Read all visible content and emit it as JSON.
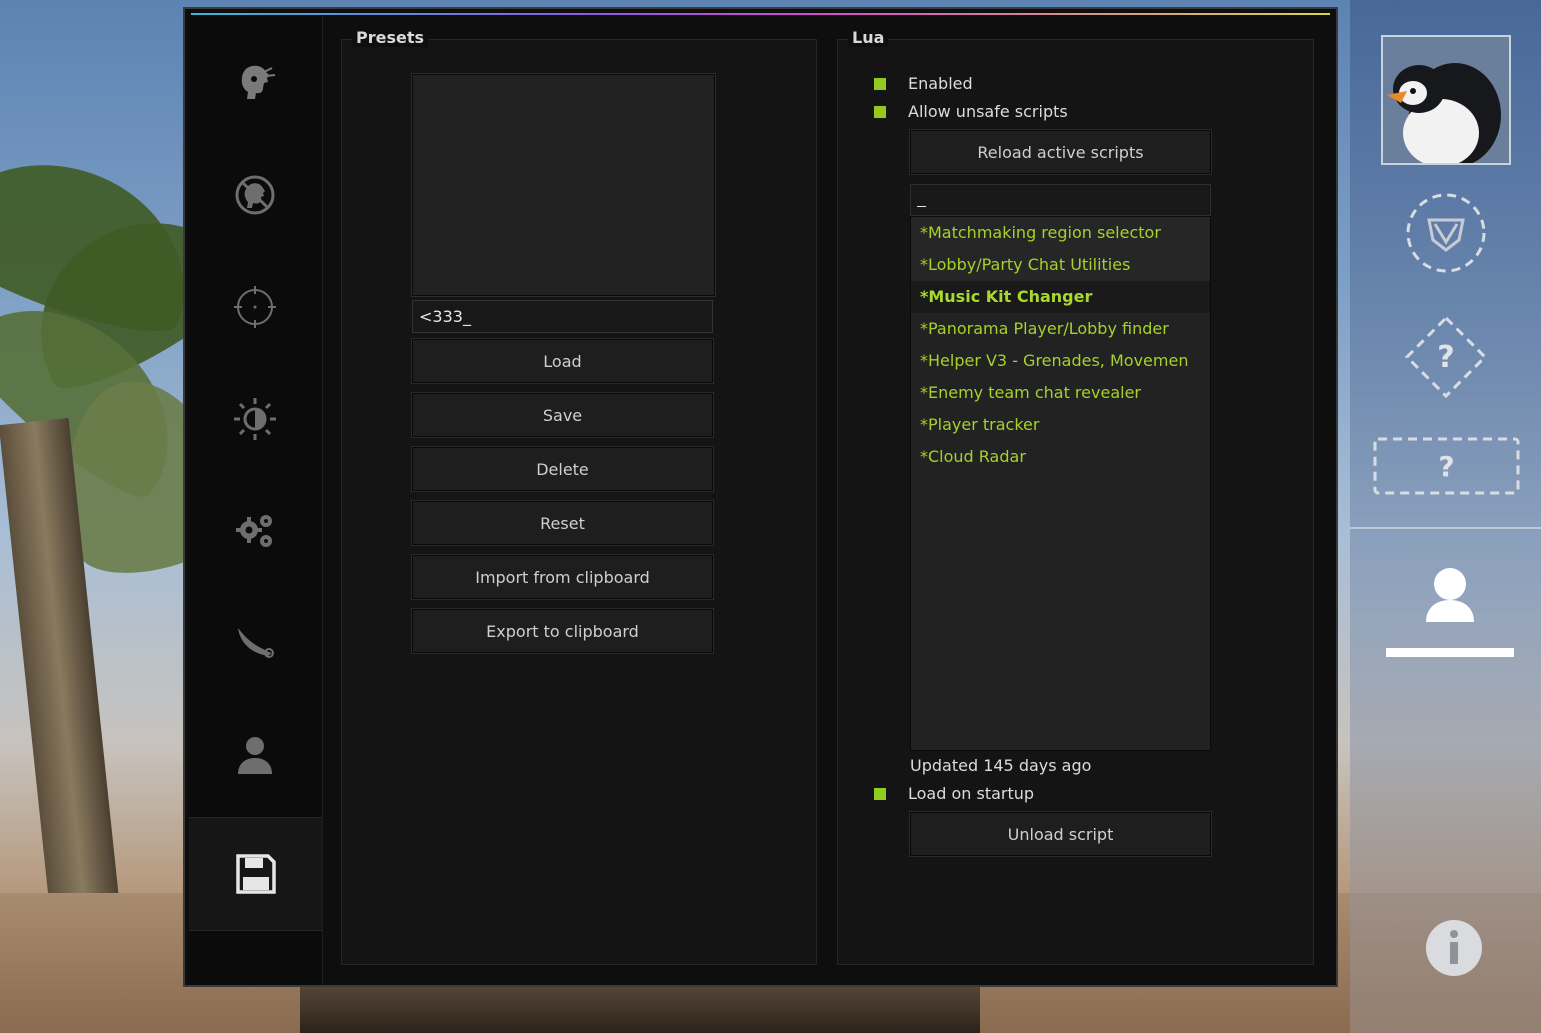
{
  "presets": {
    "title": "Presets",
    "input_value": "<333_",
    "buttons": {
      "load": "Load",
      "save": "Save",
      "delete": "Delete",
      "reset": "Reset",
      "import": "Import from clipboard",
      "export": "Export to clipboard"
    }
  },
  "lua": {
    "title": "Lua",
    "enabled_label": "Enabled",
    "allow_unsafe_label": "Allow unsafe scripts",
    "reload_button": "Reload active scripts",
    "search_value": "_",
    "scripts": [
      "*Matchmaking region selector",
      "*Lobby/Party Chat Utilities",
      "*Music Kit Changer",
      "*Panorama Player/Lobby finder",
      "*Helper V3 - Grenades, Movemen",
      "*Enemy team chat revealer",
      "*Player tracker",
      "*Cloud Radar"
    ],
    "selected_script": "*Music Kit Changer",
    "updated_text": "Updated 145 days ago",
    "load_on_startup_label": "Load on startup",
    "unload_button": "Unload script"
  },
  "tabs": [
    {
      "icon": "ragebot-icon"
    },
    {
      "icon": "antiaim-icon"
    },
    {
      "icon": "crosshair-icon"
    },
    {
      "icon": "visuals-icon"
    },
    {
      "icon": "misc-gears-icon"
    },
    {
      "icon": "skins-knife-icon"
    },
    {
      "icon": "player-icon"
    },
    {
      "icon": "config-save-icon",
      "active": true
    }
  ],
  "rightbar": {
    "placeholder_1": "?",
    "placeholder_2": "?"
  },
  "colors": {
    "accent_green": "#8fcc1f",
    "script_text": "#a5d12a",
    "background": "#0e0e0e"
  }
}
